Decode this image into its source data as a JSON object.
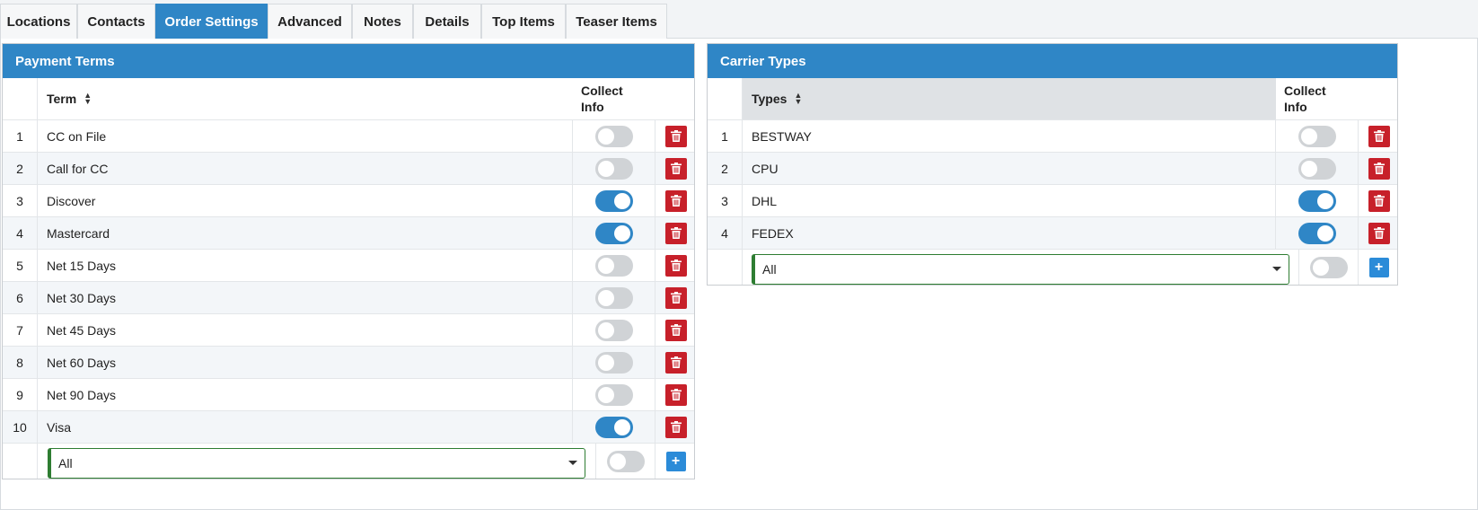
{
  "tabs": [
    {
      "label": "Locations"
    },
    {
      "label": "Contacts"
    },
    {
      "label": "Order Settings",
      "active": true
    },
    {
      "label": "Advanced"
    },
    {
      "label": "Notes"
    },
    {
      "label": "Details"
    },
    {
      "label": "Top Items"
    },
    {
      "label": "Teaser Items"
    }
  ],
  "payment_terms": {
    "title": "Payment Terms",
    "col_term": "Term",
    "col_collect_line1": "Collect",
    "col_collect_line2": "Info",
    "rows": [
      {
        "num": "1",
        "term": "CC on File",
        "collect": false
      },
      {
        "num": "2",
        "term": "Call for CC",
        "collect": false
      },
      {
        "num": "3",
        "term": "Discover",
        "collect": true
      },
      {
        "num": "4",
        "term": "Mastercard",
        "collect": true
      },
      {
        "num": "5",
        "term": "Net 15 Days",
        "collect": false
      },
      {
        "num": "6",
        "term": "Net 30 Days",
        "collect": false
      },
      {
        "num": "7",
        "term": "Net 45 Days",
        "collect": false
      },
      {
        "num": "8",
        "term": "Net 60 Days",
        "collect": false
      },
      {
        "num": "9",
        "term": "Net 90 Days",
        "collect": false
      },
      {
        "num": "10",
        "term": "Visa",
        "collect": true
      }
    ],
    "add_select_value": "All",
    "add_collect": false
  },
  "carrier_types": {
    "title": "Carrier Types",
    "col_type": "Types",
    "col_collect_line1": "Collect",
    "col_collect_line2": "Info",
    "rows": [
      {
        "num": "1",
        "type": "BESTWAY",
        "collect": false
      },
      {
        "num": "2",
        "type": "CPU",
        "collect": false
      },
      {
        "num": "3",
        "type": "DHL",
        "collect": true
      },
      {
        "num": "4",
        "type": "FEDEX",
        "collect": true
      }
    ],
    "add_select_value": "All",
    "add_collect": false
  },
  "colors": {
    "accent": "#2f86c6",
    "delete": "#c7202a",
    "add": "#2b8bd8",
    "select_border": "#2e7d32"
  },
  "icons": {
    "delete": "trash-icon",
    "add": "plus-icon",
    "sort": "sort-icon",
    "dropdown": "caret-down-icon"
  }
}
